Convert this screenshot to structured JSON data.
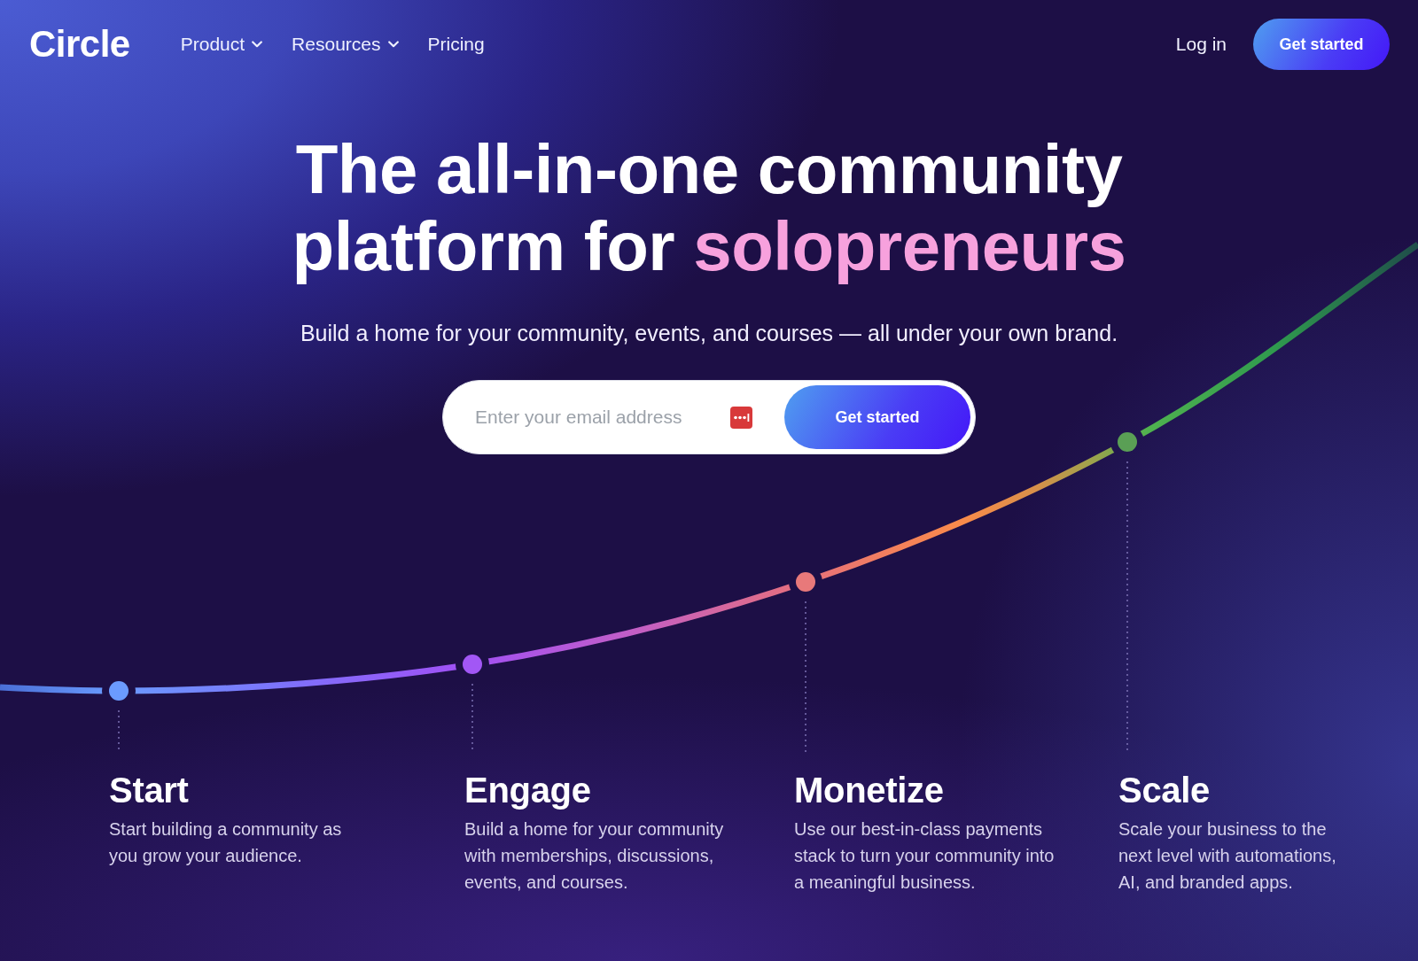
{
  "nav": {
    "logo": "Circle",
    "links": [
      {
        "label": "Product",
        "dropdown": true
      },
      {
        "label": "Resources",
        "dropdown": true
      },
      {
        "label": "Pricing",
        "dropdown": false
      }
    ],
    "login": "Log in",
    "cta": "Get started"
  },
  "hero": {
    "heading_lines": [
      "The all-in-one community",
      "platform for"
    ],
    "highlight": "solopreneurs",
    "subtitle": "Build a home for your community, events, and courses — all under your own brand.",
    "email": {
      "placeholder": "Enter your email address"
    },
    "cta": "Get started"
  },
  "stages": [
    {
      "title": "Start",
      "color": "#6b9bff",
      "description": [
        "Start building a community as",
        "you grow your audience."
      ]
    },
    {
      "title": "Engage",
      "color": "#a257f5",
      "description": [
        "Build a home for your community",
        "with memberships, discussions,",
        "events, and courses."
      ]
    },
    {
      "title": "Monetize",
      "color": "#e8797a",
      "description": [
        "Use our best-in-class payments",
        "stack to turn your community into",
        "a meaningful business."
      ]
    },
    {
      "title": "Scale",
      "color": "#5a9f55",
      "description": [
        "Scale your business to the",
        "next level with automations,",
        "AI, and branded apps."
      ]
    }
  ]
}
